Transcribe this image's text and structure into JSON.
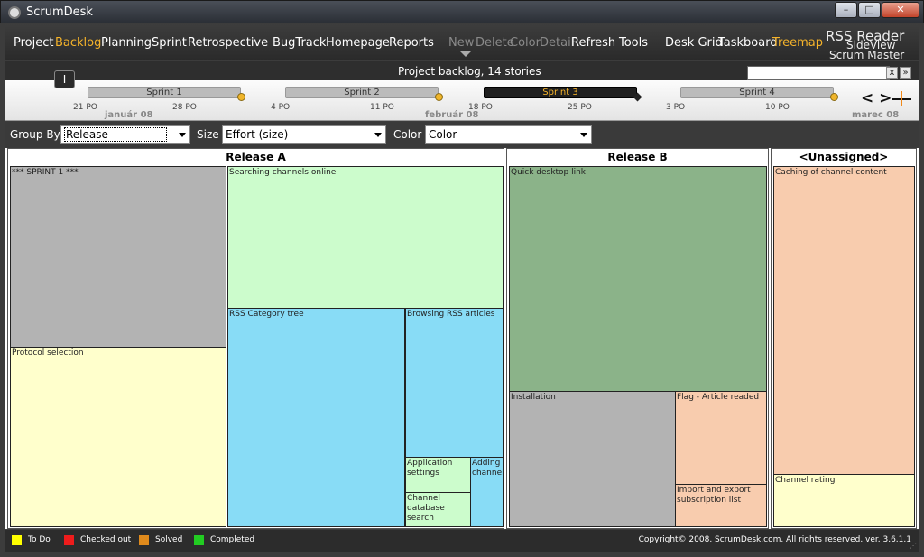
{
  "window": {
    "title": "ScrumDesk",
    "min_label": "–",
    "max_label": "□",
    "close_label": "✕"
  },
  "menu": {
    "items": [
      "Project",
      "Backlog",
      "Planning",
      "Sprint",
      "Retrospective",
      "BugTrack",
      "Homepage",
      "Reports",
      "New",
      "Delete",
      "Color",
      "Detail",
      "Refresh",
      "Tools",
      "Desk Grid",
      "Taskboard",
      "Treemap"
    ],
    "active": "Backlog",
    "disabled": [
      "New",
      "Delete",
      "Color",
      "Detail"
    ],
    "project_name": "RSS Reader",
    "project_lines": [
      "SideView",
      "Scrum Master"
    ]
  },
  "backlog": {
    "label": "Project backlog,  14 stories",
    "search_placeholder": "",
    "clear_label": "x",
    "expand_label": "»"
  },
  "info_button": "I",
  "timeline": {
    "sprints": [
      {
        "name": "Sprint 1",
        "current": false
      },
      {
        "name": "Sprint 2",
        "current": false
      },
      {
        "name": "Sprint 3",
        "current": true
      },
      {
        "name": "Sprint 4",
        "current": false
      }
    ],
    "ticks": [
      "21 PO",
      "28 PO",
      "4 PO",
      "11 PO",
      "18 PO",
      "25 PO",
      "3 PO",
      "10 PO"
    ],
    "months": [
      "január 08",
      "február 08",
      "marec 08"
    ],
    "nav": "< >"
  },
  "toolbar": {
    "group_by_label": "Group By",
    "group_by_value": "Release",
    "size_label": "Size",
    "size_value": "Effort (size)",
    "color_label": "Color",
    "color_value": "Color"
  },
  "treemap": {
    "groups": [
      {
        "title": "Release A",
        "stories": [
          {
            "name": "*** SPRINT 1 ***",
            "color": "#b3b3b3"
          },
          {
            "name": "Protocol selection",
            "color": "#ffffcc"
          },
          {
            "name": "Searching channels online",
            "color": "#ccfccc"
          },
          {
            "name": "RSS Category tree",
            "color": "#88dcf6"
          },
          {
            "name": "Browsing RSS articles",
            "color": "#88dcf6"
          },
          {
            "name": "Application settings",
            "color": "#ccfccc"
          },
          {
            "name": "Channel database search",
            "color": "#ccfccc"
          },
          {
            "name": "Adding channel",
            "color": "#88dcf6"
          }
        ]
      },
      {
        "title": "Release B",
        "stories": [
          {
            "name": "Quick desktop link",
            "color": "#8bb389"
          },
          {
            "name": "Installation",
            "color": "#b3b3b3"
          },
          {
            "name": "Flag - Article readed",
            "color": "#f8ccae"
          },
          {
            "name": "Import and export subscription list",
            "color": "#f8ccae"
          }
        ]
      },
      {
        "title": "<Unassigned>",
        "stories": [
          {
            "name": "Caching of channel content",
            "color": "#f8ccae"
          },
          {
            "name": "Channel rating",
            "color": "#ffffcc"
          }
        ]
      }
    ]
  },
  "legend": [
    {
      "label": "To Do",
      "color": "#ffff00"
    },
    {
      "label": "Checked out",
      "color": "#ee1c1c"
    },
    {
      "label": "Solved",
      "color": "#e08a1c"
    },
    {
      "label": "Completed",
      "color": "#22cc22"
    }
  ],
  "copyright": "Copyright© 2008. ScrumDesk.com. All rights reserved. ver. 3.6.1.1"
}
